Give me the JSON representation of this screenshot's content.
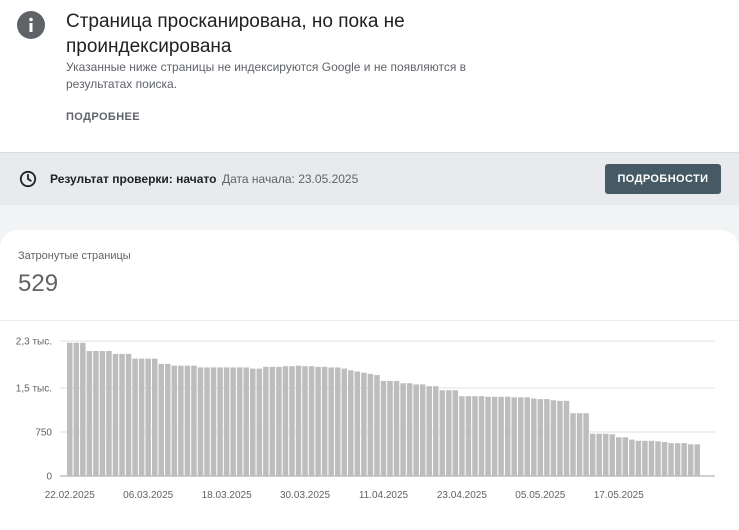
{
  "header": {
    "icon": "info-icon",
    "title": "Страница просканирована, но пока не проиндексирована",
    "description": "Указанные ниже страницы не индексируются Google и не появляются в результатах поиска.",
    "more_link": "ПОДРОБНЕЕ"
  },
  "validation": {
    "icon": "clock-icon",
    "result_label": "Результат проверки: начато",
    "start_date": "Дата начала: 23.05.2025",
    "details_button": "ПОДРОБНОСТИ"
  },
  "summary": {
    "label": "Затронутые страницы",
    "value": "529"
  },
  "colors": {
    "bar": "#bdbdbd",
    "button": "#455a64",
    "band": "#e8eaed"
  },
  "chart_data": {
    "type": "bar",
    "title": "",
    "xlabel": "",
    "ylabel": "",
    "ylim": [
      0,
      2300
    ],
    "y_ticks": [
      0,
      750,
      1500,
      2300
    ],
    "y_tick_labels": [
      "0",
      "750",
      "1,5 тыс.",
      "2,3 тыс."
    ],
    "x_tick_labels": [
      "22.02.2025",
      "06.03.2025",
      "18.03.2025",
      "30.03.2025",
      "11.04.2025",
      "23.04.2025",
      "05.05.2025",
      "17.05.2025"
    ],
    "x_tick_indices": [
      0,
      12,
      24,
      36,
      48,
      60,
      72,
      84
    ],
    "grid": true,
    "values": [
      2270,
      2270,
      2270,
      2130,
      2130,
      2130,
      2130,
      2080,
      2080,
      2080,
      2000,
      2000,
      2000,
      2000,
      1910,
      1910,
      1880,
      1880,
      1880,
      1880,
      1850,
      1850,
      1850,
      1850,
      1850,
      1850,
      1850,
      1850,
      1830,
      1830,
      1860,
      1860,
      1860,
      1870,
      1870,
      1880,
      1870,
      1870,
      1860,
      1860,
      1850,
      1850,
      1830,
      1800,
      1780,
      1760,
      1740,
      1720,
      1620,
      1620,
      1620,
      1580,
      1580,
      1560,
      1560,
      1530,
      1530,
      1460,
      1460,
      1460,
      1360,
      1360,
      1360,
      1360,
      1350,
      1350,
      1350,
      1350,
      1340,
      1340,
      1340,
      1320,
      1310,
      1310,
      1290,
      1280,
      1280,
      1070,
      1070,
      1070,
      720,
      720,
      720,
      710,
      660,
      660,
      620,
      600,
      600,
      600,
      590,
      580,
      560,
      560,
      560,
      540,
      540
    ]
  }
}
